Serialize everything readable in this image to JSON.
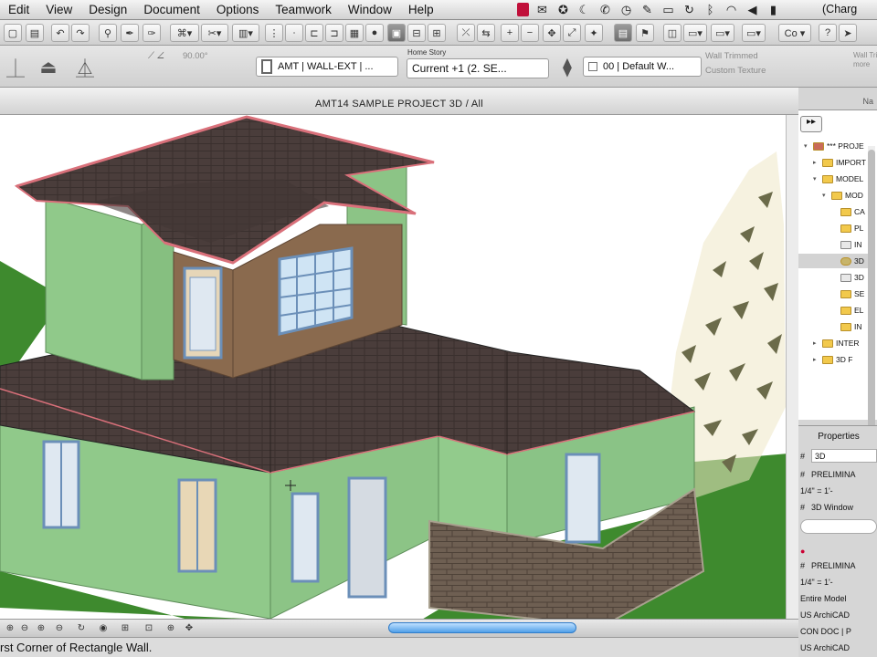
{
  "menubar": {
    "items": [
      "Edit",
      "View",
      "Design",
      "Document",
      "Options",
      "Teamwork",
      "Window",
      "Help"
    ],
    "charge_text": "(Charg"
  },
  "toolbar2": {
    "angle_value": "90.00°",
    "wall_composite": "AMT | WALL-EXT | ...",
    "home_story_label": "Home Story",
    "home_story_value": "Current +1 (2. SE...",
    "layer_value": "00 | Default W...",
    "wall_trimmed": "Wall Trimmed",
    "custom_texture": "Custom Texture",
    "wall_label_right": "Wall Trimm",
    "wall_label_right2": "more"
  },
  "viewport": {
    "title": "AMT14 SAMPLE PROJECT 3D / All"
  },
  "status": {
    "message": "rst Corner of Rectangle Wall."
  },
  "navigator": {
    "header": "Na",
    "items": [
      {
        "label": "*** PROJE",
        "indent": 0,
        "arrow": "▾",
        "icon": "project"
      },
      {
        "label": "IMPORT",
        "indent": 1,
        "arrow": "▸",
        "icon": "folder"
      },
      {
        "label": "MODEL",
        "indent": 1,
        "arrow": "▾",
        "icon": "folder"
      },
      {
        "label": "MOD",
        "indent": 2,
        "arrow": "▾",
        "icon": "folder"
      },
      {
        "label": "CA",
        "indent": 3,
        "arrow": "",
        "icon": "folder"
      },
      {
        "label": "PL",
        "indent": 3,
        "arrow": "",
        "icon": "folder"
      },
      {
        "label": "IN",
        "indent": 3,
        "arrow": "",
        "icon": "view"
      },
      {
        "label": "3D",
        "indent": 3,
        "arrow": "",
        "icon": "3d",
        "selected": true
      },
      {
        "label": "3D",
        "indent": 3,
        "arrow": "",
        "icon": "view"
      },
      {
        "label": "SE",
        "indent": 3,
        "arrow": "",
        "icon": "folder"
      },
      {
        "label": "EL",
        "indent": 3,
        "arrow": "",
        "icon": "folder"
      },
      {
        "label": "IN",
        "indent": 3,
        "arrow": "",
        "icon": "folder"
      },
      {
        "label": "INTER",
        "indent": 1,
        "arrow": "▸",
        "icon": "folder"
      },
      {
        "label": "3D F",
        "indent": 1,
        "arrow": "▸",
        "icon": "folder"
      }
    ]
  },
  "properties": {
    "title": "Properties",
    "value_3d": "3D",
    "row_prelim1": "PRELIMINA",
    "row_scale1": "1/4\"  =  1'-",
    "row_3dwin": "3D Window",
    "row_prelim2": "PRELIMINA",
    "row_scale2": "1/4\"  =  1'-",
    "row_entire": "Entire Model",
    "row_us": "US ArchiCAD",
    "row_con": "CON DOC | P",
    "row_us2": "US ArchiCAD"
  },
  "colors": {
    "wall_green": "#90c98a",
    "roof": "#4a3d3b",
    "roof_edge": "#d9707a",
    "brown_wall": "#8a6a4e",
    "grass": "#3e8a2e",
    "stone": "#6e5f52"
  }
}
